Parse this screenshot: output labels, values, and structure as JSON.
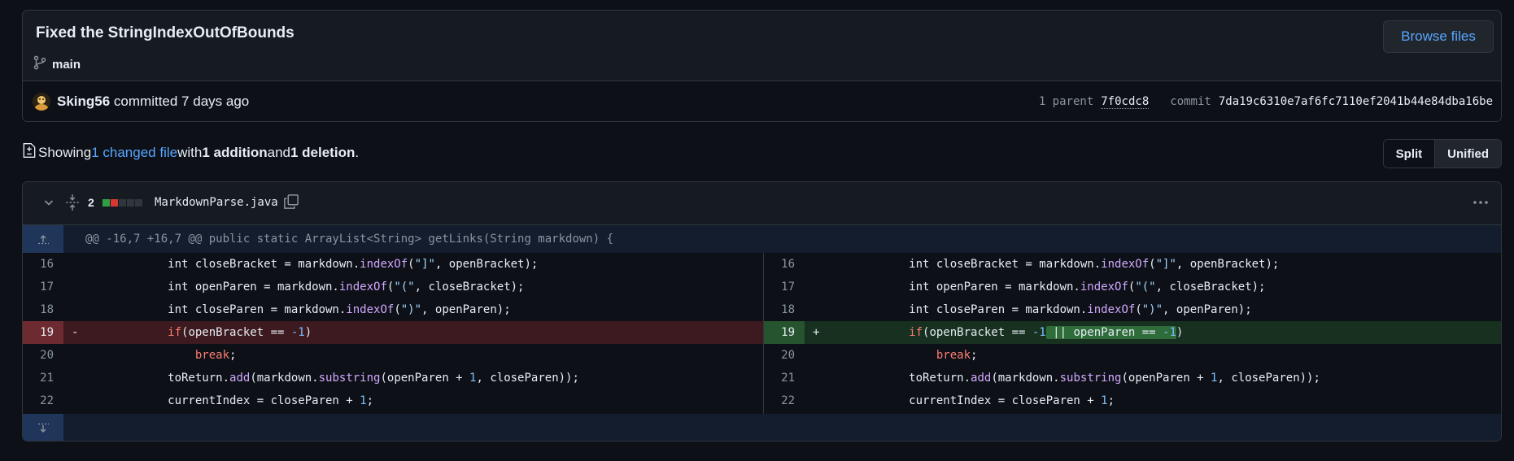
{
  "commit": {
    "title": "Fixed the StringIndexOutOfBounds",
    "branch": "main",
    "browse_label": "Browse files",
    "author": "Sking56",
    "action_text": " committed 7 days ago",
    "parent_label": "1 parent",
    "parent_sha": "7f0cdc8",
    "commit_label": "commit",
    "commit_sha": "7da19c6310e7af6fc7110ef2041b44e84dba16be"
  },
  "summary": {
    "prefix": "Showing ",
    "changed_files": "1 changed file",
    "with": " with ",
    "additions": "1 addition",
    "and": " and ",
    "deletions": "1 deletion",
    "suffix": "."
  },
  "view_toggle": {
    "split": "Split",
    "unified": "Unified",
    "selected": "Split"
  },
  "file": {
    "change_count": "2",
    "name": "MarkdownParse.java",
    "hunk_header": "@@ -16,7 +16,7 @@ public static ArrayList<String> getLinks(String markdown) {",
    "left_lines": [
      {
        "num": "16",
        "type": "ctx"
      },
      {
        "num": "17",
        "type": "ctx"
      },
      {
        "num": "18",
        "type": "ctx"
      },
      {
        "num": "19",
        "type": "del",
        "sign": "-"
      },
      {
        "num": "20",
        "type": "ctx"
      },
      {
        "num": "21",
        "type": "ctx"
      },
      {
        "num": "22",
        "type": "ctx"
      }
    ],
    "right_lines": [
      {
        "num": "16",
        "type": "ctx"
      },
      {
        "num": "17",
        "type": "ctx"
      },
      {
        "num": "18",
        "type": "ctx"
      },
      {
        "num": "19",
        "type": "add",
        "sign": "+"
      },
      {
        "num": "20",
        "type": "ctx"
      },
      {
        "num": "21",
        "type": "ctx"
      },
      {
        "num": "22",
        "type": "ctx"
      }
    ],
    "code": {
      "l16": "            int closeBracket = markdown.indexOf(\"]\", openBracket);",
      "l17": "            int openParen = markdown.indexOf(\"(\", closeBracket);",
      "l18": "            int closeParen = markdown.indexOf(\")\", openParen);",
      "l19_left": "            if(openBracket == -1)",
      "l19_right_a": "            if(openBracket == -1",
      "l19_right_hl": " || openParen == -1",
      "l19_right_b": ")",
      "l20": "                break;",
      "l21": "            toReturn.add(markdown.substring(openParen + 1, closeParen));",
      "l22": "            currentIndex = closeParen + 1;"
    }
  },
  "colors": {
    "accent": "#58a6ff",
    "addition": "#2ea043",
    "deletion": "#da3633",
    "background": "#0d1117"
  },
  "icons": [
    "git-branch-icon",
    "file-diff-icon",
    "chevron-down-icon",
    "expand-icon",
    "copy-icon",
    "kebab-icon",
    "expand-up-icon",
    "expand-down-icon"
  ]
}
